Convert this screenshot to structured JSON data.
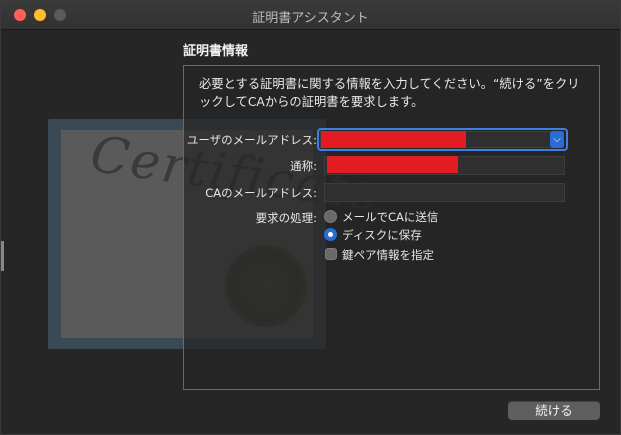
{
  "window": {
    "title": "証明書アシスタント"
  },
  "section": {
    "title": "証明書情報"
  },
  "description": "必要とする証明書に関する情報を入力してください。“続ける”をクリックしてCAからの証明書を要求します。",
  "decoration": {
    "certificate_text": "Certificate"
  },
  "form": {
    "email_label": "ユーザのメールアドレス:",
    "common_name_label": "通称:",
    "ca_email_label": "CAのメールアドレス:",
    "ca_email_value": "",
    "request_label": "要求の処理:",
    "options": [
      {
        "label": "メールでCAに送信",
        "selected": false
      },
      {
        "label": "ディスクに保存",
        "selected": true
      }
    ],
    "keypair_label": "鍵ペア情報を指定",
    "keypair_checked": false
  },
  "buttons": {
    "continue": "続ける"
  },
  "icons": {
    "combo_arrow": "chevron-down-icon"
  },
  "colors": {
    "accent": "#2a6bd6",
    "redaction": "#e11c23"
  }
}
